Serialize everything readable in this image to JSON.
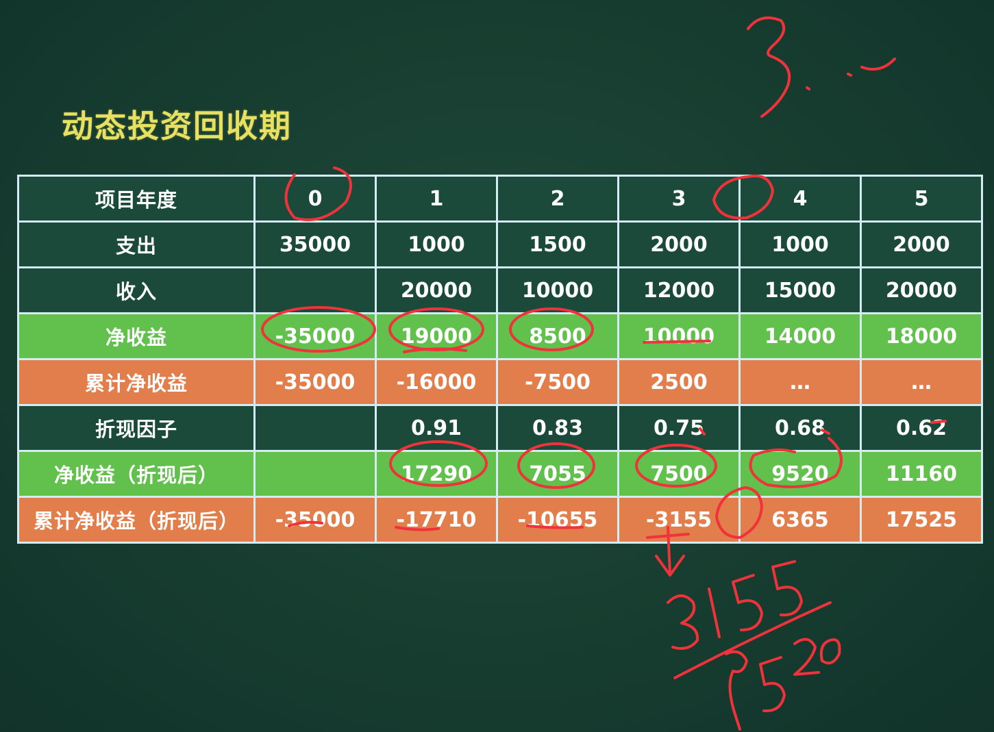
{
  "title": "动态投资回收期",
  "table": {
    "header": {
      "label": "项目年度",
      "cells": [
        "0",
        "1",
        "2",
        "3",
        "4",
        "5"
      ]
    },
    "rows": [
      {
        "label": "支出",
        "style": "dark",
        "cells": [
          "35000",
          "1000",
          "1500",
          "2000",
          "1000",
          "2000"
        ]
      },
      {
        "label": "收入",
        "style": "dark",
        "cells": [
          "",
          "20000",
          "10000",
          "12000",
          "15000",
          "20000"
        ]
      },
      {
        "label": "净收益",
        "style": "green",
        "cells": [
          "-35000",
          "19000",
          "8500",
          "10000",
          "14000",
          "18000"
        ]
      },
      {
        "label": "累计净收益",
        "style": "orange",
        "cells": [
          "-35000",
          "-16000",
          "-7500",
          "2500",
          "…",
          "…"
        ]
      },
      {
        "label": "折现因子",
        "style": "dark",
        "cells": [
          "",
          "0.91",
          "0.83",
          "0.75",
          "0.68",
          "0.62"
        ]
      },
      {
        "label": "净收益（折现后）",
        "style": "green",
        "cells": [
          "",
          "17290",
          "7055",
          "7500",
          "9520",
          "11160"
        ]
      },
      {
        "label": "累计净收益（折现后）",
        "style": "orange",
        "cells": [
          "-35000",
          "-17710",
          "-10655",
          "-3155",
          "6365",
          "17525"
        ]
      }
    ]
  },
  "colors": {
    "background": "#173d30",
    "title": "#e8e060",
    "dark_row": "#1b4a3b",
    "green_row": "#62c04d",
    "orange_row": "#e27e4b",
    "grid": "#d4ecf4",
    "ink": "#f0323a"
  }
}
